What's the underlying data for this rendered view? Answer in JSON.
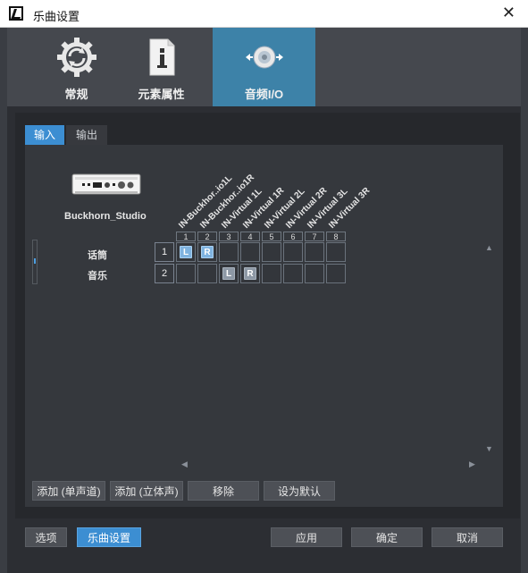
{
  "window": {
    "title": "乐曲设置"
  },
  "nav": {
    "tabs": [
      {
        "label": "常规"
      },
      {
        "label": "元素属性"
      },
      {
        "label": "音频I/O"
      }
    ],
    "active": "音频I/O"
  },
  "subtabs": {
    "input": "输入",
    "output": "输出",
    "active": "输入"
  },
  "device": {
    "name": "Buckhorn_Studio"
  },
  "matrix": {
    "columns": [
      "IN-Buckhor..io1L",
      "IN-Buckhor..io1R",
      "IN-Virtual 1L",
      "IN-Virtual 1R",
      "IN-Virtual 2L",
      "IN-Virtual 2R",
      "IN-Virtual 3L",
      "IN-Virtual 3R"
    ],
    "column_numbers": [
      "1",
      "2",
      "3",
      "4",
      "5",
      "6",
      "7",
      "8"
    ],
    "rows": [
      {
        "label": "话筒",
        "num": "1",
        "cells": [
          "L",
          "R",
          "",
          "",
          "",
          "",
          "",
          ""
        ]
      },
      {
        "label": "音乐",
        "num": "2",
        "cells": [
          "",
          "",
          "L",
          "R",
          "",
          "",
          "",
          ""
        ]
      }
    ]
  },
  "buttons": {
    "add_mono": "添加 (单声道)",
    "add_stereo": "添加 (立体声)",
    "remove": "移除",
    "set_default": "设为默认"
  },
  "footer": {
    "options": "选项",
    "song_settings": "乐曲设置",
    "apply": "应用",
    "ok": "确定",
    "cancel": "取消"
  },
  "colors": {
    "accent": "#3c8ed2",
    "active_tab": "#3d82a8"
  }
}
